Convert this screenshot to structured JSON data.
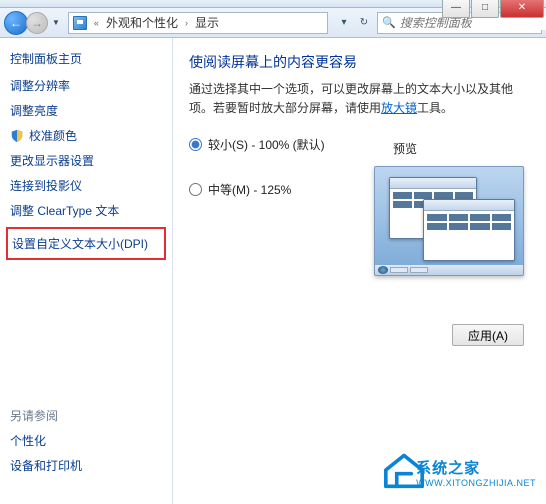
{
  "titlebar": {
    "close": "✕",
    "max": "□",
    "min": "—"
  },
  "nav": {
    "back": "←",
    "fwd": "→",
    "drop": "▼",
    "crumbs": {
      "chev_pre": "«",
      "crumb1": "外观和个性化",
      "sep1": "›",
      "crumb2": "显示"
    },
    "refresh": "↻",
    "dd": "▾",
    "search_placeholder": "搜索控制面板"
  },
  "sidebar": {
    "home": "控制面板主页",
    "links": [
      "调整分辨率",
      "调整亮度",
      "校准颜色",
      "更改显示器设置",
      "连接到投影仪",
      "调整 ClearType 文本"
    ],
    "dpi": "设置自定义文本大小(DPI)",
    "see_also": "另请参阅",
    "see_links": [
      "个性化",
      "设备和打印机"
    ]
  },
  "content": {
    "title": "使阅读屏幕上的内容更容易",
    "desc_prefix": "通过选择其中一个选项，可以更改屏幕上的文本大小以及其他项。若要暂时放大部分屏幕，请使用",
    "desc_link": "放大镜",
    "desc_suffix": "工具。",
    "opt_small": "较小(S) - 100% (默认)",
    "opt_medium": "中等(M) - 125%",
    "preview_label": "预览",
    "apply": "应用(A)"
  },
  "watermark": {
    "name": "系统之家",
    "url": "WWW.XITONGZHIJIA.NET"
  }
}
